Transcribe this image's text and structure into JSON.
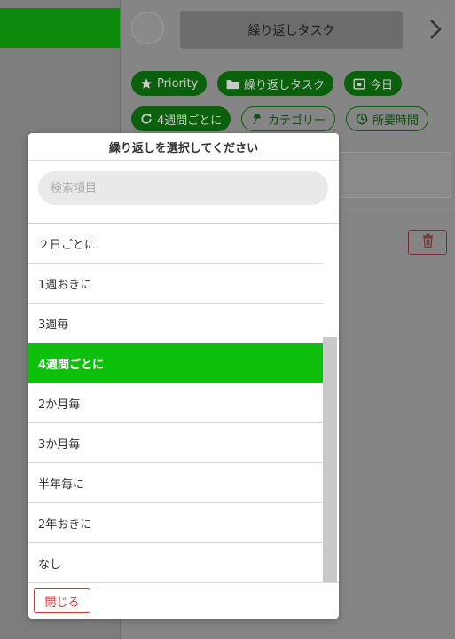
{
  "panel": {
    "title_button": "繰り返しタスク",
    "chips": [
      {
        "label": "Priority",
        "icon": "star-icon",
        "style": "filled"
      },
      {
        "label": "繰り返しタスク",
        "icon": "folder-icon",
        "style": "filled"
      },
      {
        "label": "今日",
        "icon": "calendar-icon",
        "style": "filled"
      },
      {
        "label": "4週間ごとに",
        "icon": "repeat-icon",
        "style": "filled"
      },
      {
        "label": "カテゴリー",
        "icon": "pin-icon",
        "style": "outlined"
      },
      {
        "label": "所要時間",
        "icon": "clock-icon",
        "style": "outlined"
      }
    ]
  },
  "modal": {
    "title": "繰り返しを選択してください",
    "search_placeholder": "検索項目",
    "items": [
      {
        "label": "２日ごとに",
        "selected": false
      },
      {
        "label": "1週おきに",
        "selected": false
      },
      {
        "label": "3週毎",
        "selected": false
      },
      {
        "label": "4週間ごとに",
        "selected": true
      },
      {
        "label": "2か月毎",
        "selected": false
      },
      {
        "label": "3か月毎",
        "selected": false
      },
      {
        "label": "半年毎に",
        "selected": false
      },
      {
        "label": "2年おきに",
        "selected": false
      },
      {
        "label": "なし",
        "selected": false
      }
    ],
    "close_label": "閉じる"
  },
  "colors": {
    "accent": "#0cc00c",
    "danger": "#c93a3a"
  }
}
